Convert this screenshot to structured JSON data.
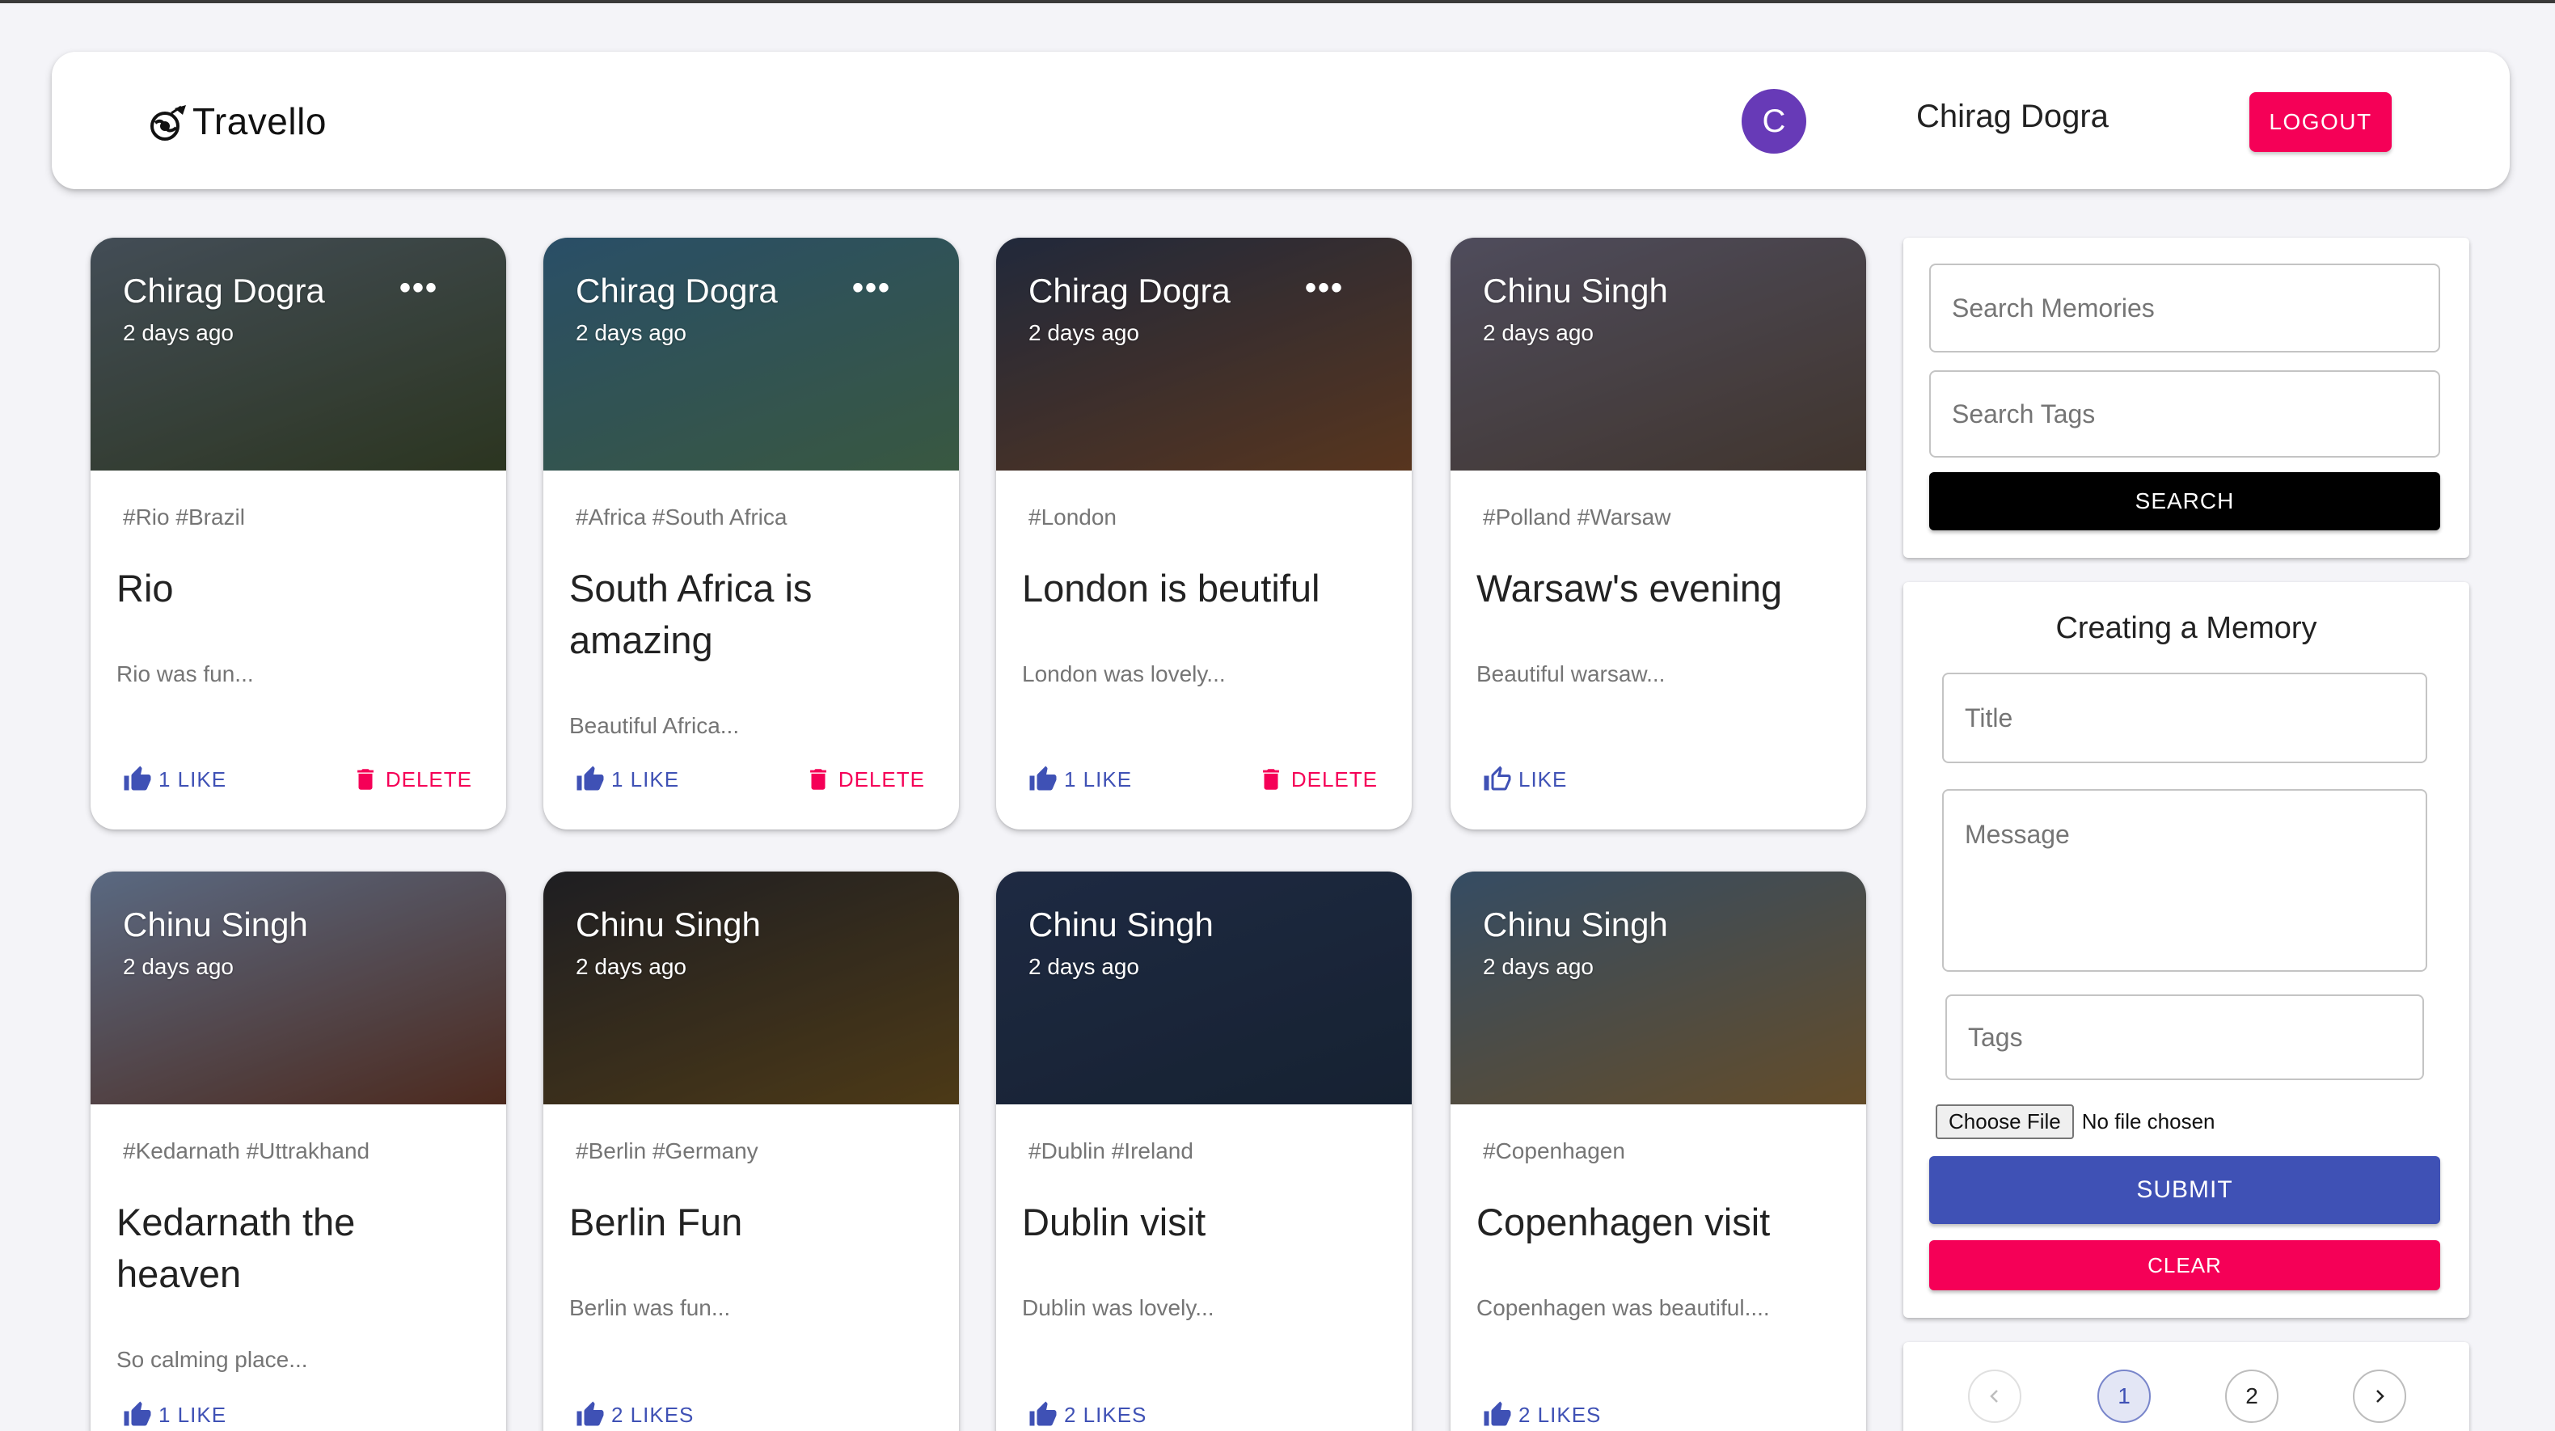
{
  "header": {
    "brand": "Travello",
    "avatar_initial": "C",
    "user_name": "Chirag Dogra",
    "logout_label": "LOGOUT"
  },
  "posts": [
    {
      "author": "Chirag Dogra",
      "time": "2 days ago",
      "tags": "#Rio #Brazil",
      "title": "Rio",
      "message": "Rio was fun...",
      "like_label": "1 LIKE",
      "liked": true,
      "delete_label": "DELETE",
      "owner": true,
      "image_colors": [
        "#5d6b78",
        "#3d4a2d"
      ]
    },
    {
      "author": "Chirag Dogra",
      "time": "2 days ago",
      "tags": "#Africa #South Africa",
      "title": "South Africa is amazing",
      "message": "Beautiful Africa...",
      "like_label": "1 LIKE",
      "liked": true,
      "delete_label": "DELETE",
      "owner": true,
      "image_colors": [
        "#3a6d8f",
        "#4f7a5a"
      ]
    },
    {
      "author": "Chirag Dogra",
      "time": "2 days ago",
      "tags": "#London",
      "title": "London is beutiful",
      "message": "London was lovely...",
      "like_label": "1 LIKE",
      "liked": true,
      "delete_label": "DELETE",
      "owner": true,
      "image_colors": [
        "#2e3952",
        "#7a4a2a"
      ]
    },
    {
      "author": "Chinu Singh",
      "time": "2 days ago",
      "tags": "#Polland #Warsaw",
      "title": "Warsaw's evening",
      "message": "Beautiful warsaw...",
      "like_label": "LIKE",
      "liked": false,
      "delete_label": "",
      "owner": false,
      "image_colors": [
        "#6d6a80",
        "#5a4a40"
      ]
    },
    {
      "author": "Chinu Singh",
      "time": "2 days ago",
      "tags": "#Kedarnath #Uttrakhand",
      "title": "Kedarnath the heaven",
      "message": "So calming place...",
      "like_label": "1 LIKE",
      "liked": true,
      "delete_label": "",
      "owner": false,
      "image_colors": [
        "#7d92b4",
        "#6a3a2a"
      ]
    },
    {
      "author": "Chinu Singh",
      "time": "2 days ago",
      "tags": "#Berlin #Germany",
      "title": "Berlin Fun",
      "message": "Berlin was fun...",
      "like_label": "2 LIKES",
      "liked": true,
      "delete_label": "",
      "owner": false,
      "image_colors": [
        "#2a2a30",
        "#6a5020"
      ]
    },
    {
      "author": "Chinu Singh",
      "time": "2 days ago",
      "tags": "#Dublin #Ireland",
      "title": "Dublin visit",
      "message": "Dublin was lovely...",
      "like_label": "2 LIKES",
      "liked": true,
      "delete_label": "",
      "owner": false,
      "image_colors": [
        "#2a3a5c",
        "#1f2f45"
      ]
    },
    {
      "author": "Chinu Singh",
      "time": "2 days ago",
      "tags": "#Copenhagen",
      "title": "Copenhagen visit",
      "message": "Copenhagen was beautiful....",
      "like_label": "2 LIKES",
      "liked": true,
      "delete_label": "",
      "owner": false,
      "image_colors": [
        "#4a6a8a",
        "#8a6a3a"
      ]
    }
  ],
  "search": {
    "memories_placeholder": "Search Memories",
    "tags_placeholder": "Search Tags",
    "button_label": "SEARCH"
  },
  "form": {
    "heading": "Creating a Memory",
    "title_placeholder": "Title",
    "message_placeholder": "Message",
    "tags_placeholder": "Tags",
    "file_button": "Choose File",
    "file_status": "No file chosen",
    "submit_label": "SUBMIT",
    "clear_label": "CLEAR"
  },
  "pagination": {
    "pages": [
      "1",
      "2"
    ],
    "current": "1"
  },
  "colors": {
    "primary": "#3f51b5",
    "secondary": "#f50057",
    "avatar": "#673ab7"
  }
}
